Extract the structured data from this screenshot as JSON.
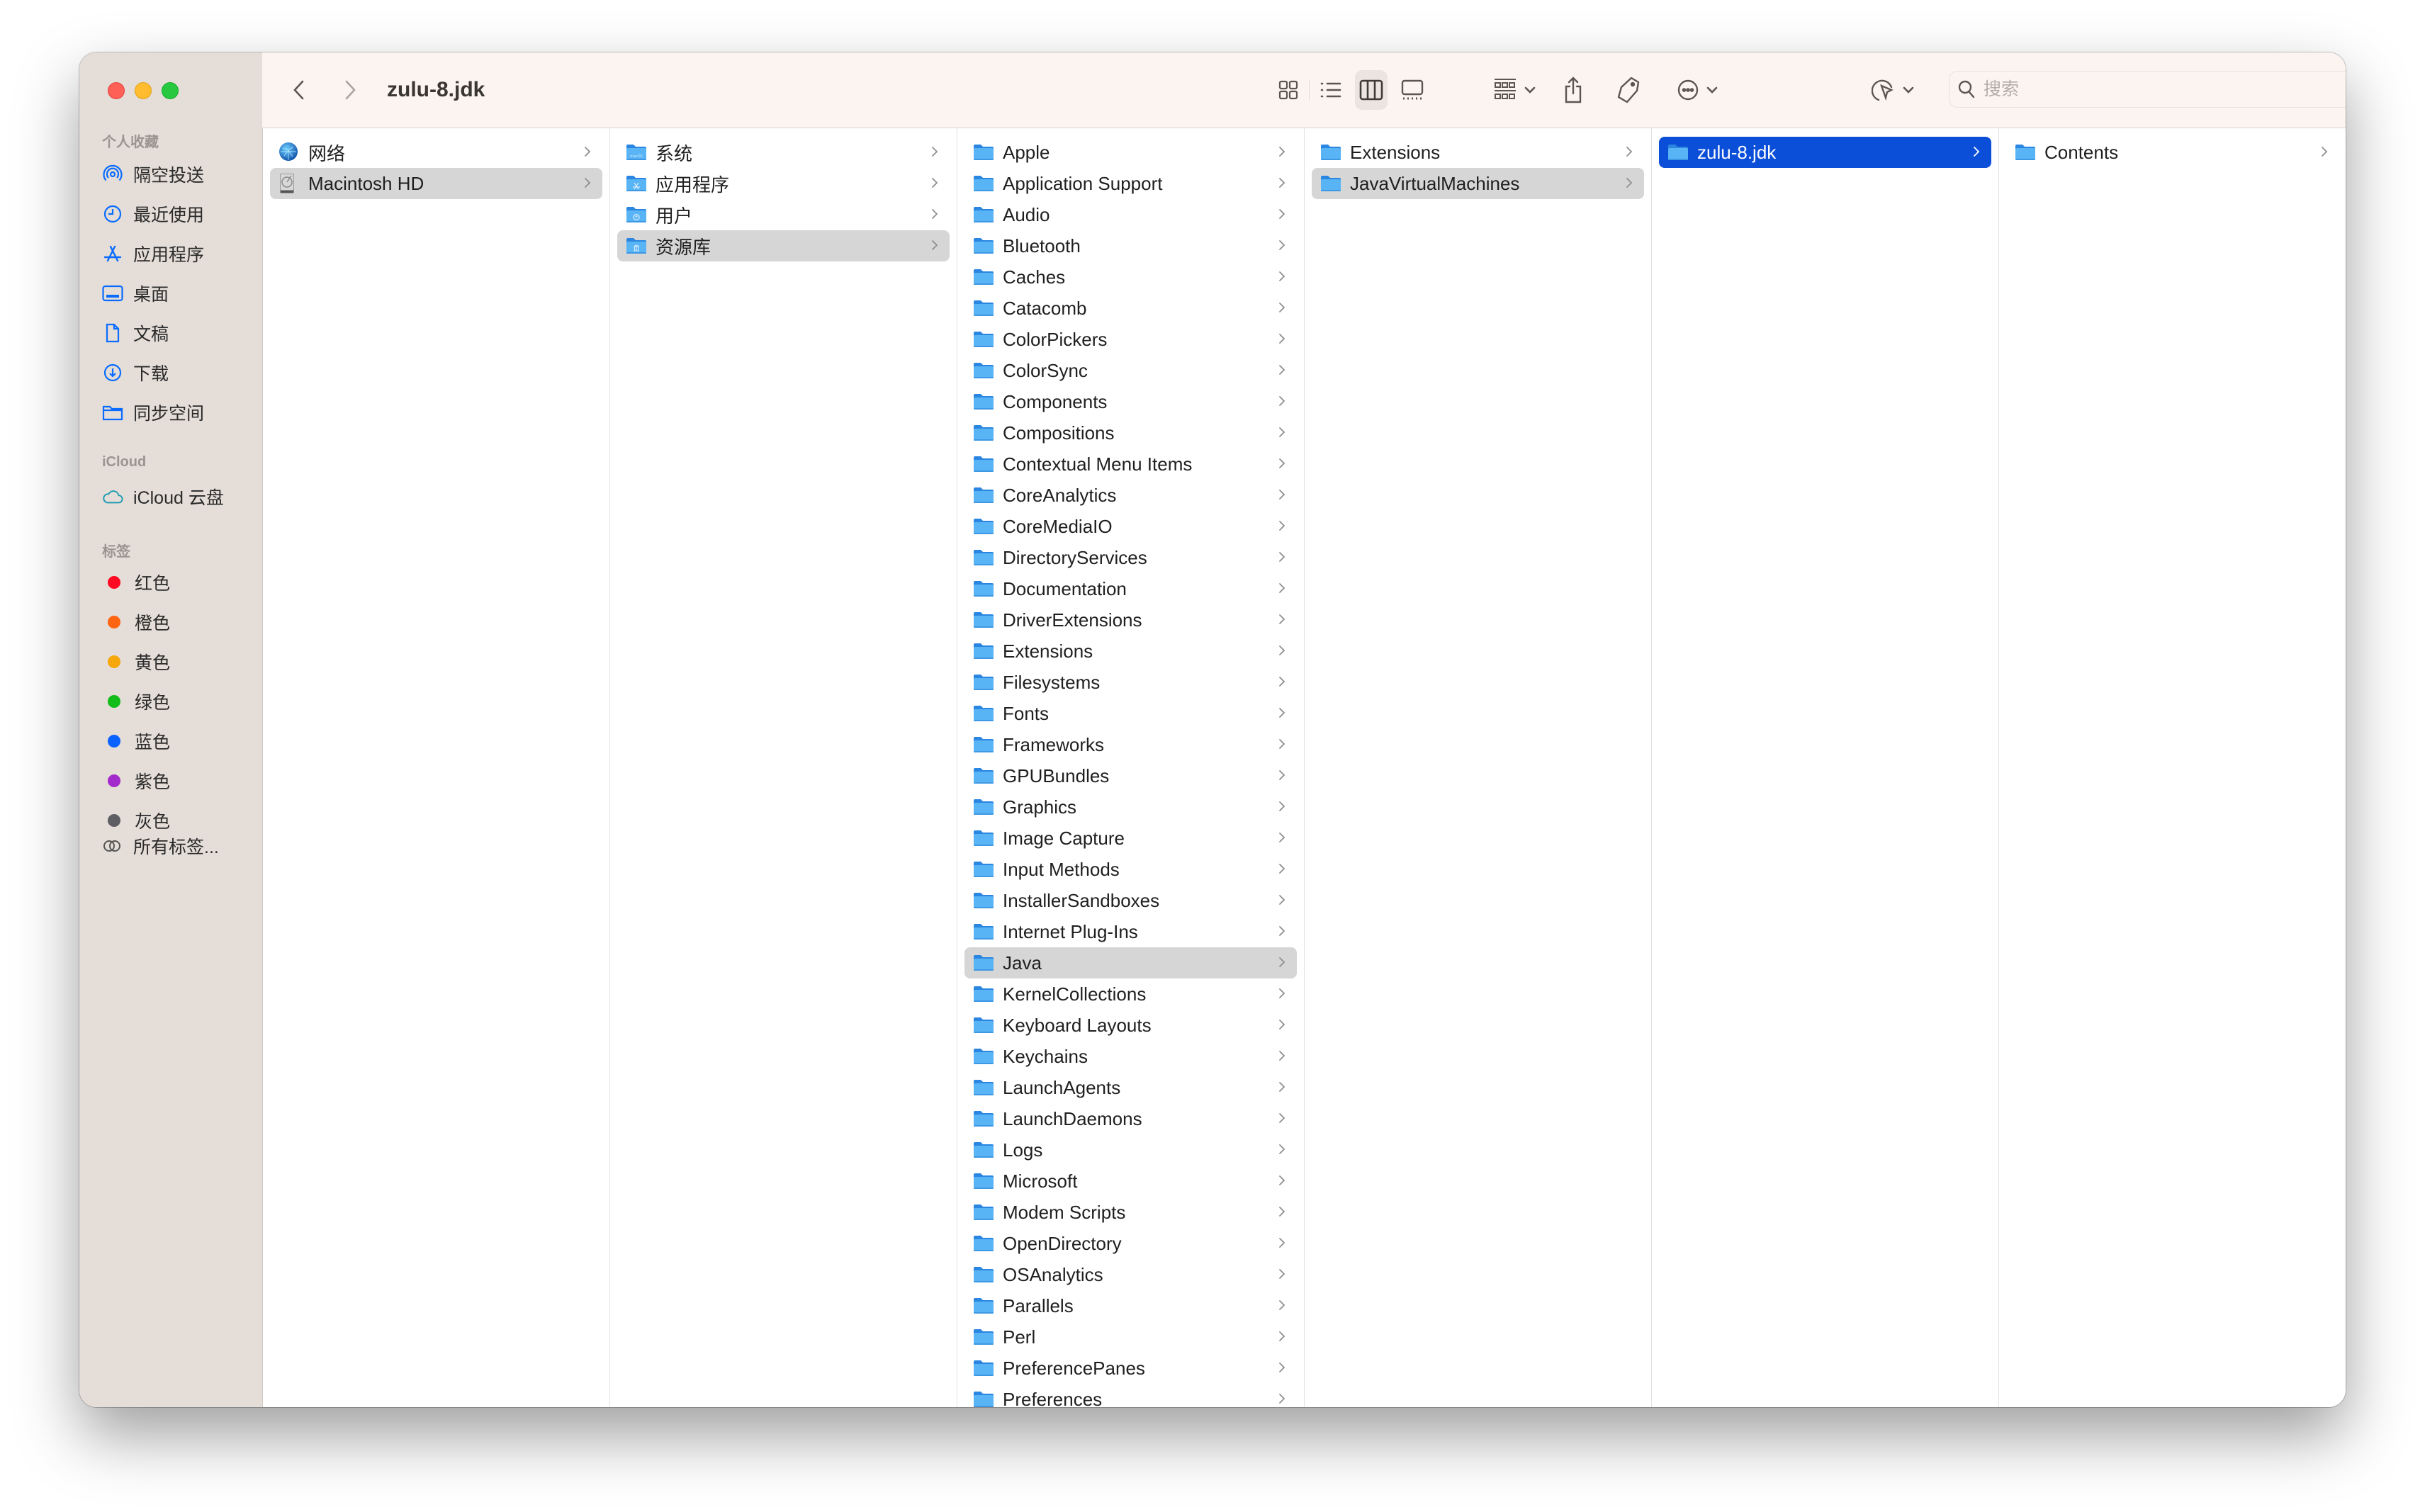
{
  "window": {
    "title": "zulu-8.jdk"
  },
  "toolbar": {
    "back_icon": "chevron-left-icon",
    "forward_icon": "chevron-right-icon",
    "view_icons": [
      "icon-view-icon",
      "list-view-icon",
      "column-view-icon",
      "gallery-view-icon"
    ],
    "active_view": "column-view-icon",
    "group_icon": "group-by-icon",
    "share_icon": "share-icon",
    "tag_icon": "tag-icon",
    "more_icon": "ellipsis-circle-icon",
    "airdrop_icon": "airdrop-icon",
    "search": {
      "placeholder": "搜索",
      "value": ""
    }
  },
  "sidebar": {
    "favorites_label": "个人收藏",
    "favorites": [
      {
        "label": "隔空投送",
        "icon": "airdrop-icon"
      },
      {
        "label": "最近使用",
        "icon": "clock-icon"
      },
      {
        "label": "应用程序",
        "icon": "applications-icon"
      },
      {
        "label": "桌面",
        "icon": "desktop-icon"
      },
      {
        "label": "文稿",
        "icon": "document-icon"
      },
      {
        "label": "下载",
        "icon": "download-icon"
      },
      {
        "label": "同步空间",
        "icon": "folder-icon"
      }
    ],
    "icloud_label": "iCloud",
    "icloud": [
      {
        "label": "iCloud 云盘",
        "icon": "cloud-icon"
      }
    ],
    "tags_label": "标签",
    "tags": [
      {
        "label": "红色",
        "color": "#FF0A22"
      },
      {
        "label": "橙色",
        "color": "#FF6510"
      },
      {
        "label": "黄色",
        "color": "#F5A70B"
      },
      {
        "label": "绿色",
        "color": "#14BC1A"
      },
      {
        "label": "蓝色",
        "color": "#0A63FF"
      },
      {
        "label": "紫色",
        "color": "#A42BCB"
      },
      {
        "label": "灰色",
        "color": "#5F5F63"
      }
    ],
    "all_tags": {
      "label": "所有标签...",
      "icon": "all-tags-icon"
    }
  },
  "columns": [
    {
      "items": [
        {
          "label": "网络",
          "icon": "network-globe-icon"
        },
        {
          "label": "Macintosh HD",
          "icon": "hard-drive-icon",
          "state": "path"
        }
      ]
    },
    {
      "items": [
        {
          "label": "系统",
          "icon": "system-folder-icon"
        },
        {
          "label": "应用程序",
          "icon": "applications-folder-icon"
        },
        {
          "label": "用户",
          "icon": "users-folder-icon"
        },
        {
          "label": "资源库",
          "icon": "library-folder-icon",
          "state": "path"
        }
      ]
    },
    {
      "items": [
        {
          "label": "Apple"
        },
        {
          "label": "Application Support"
        },
        {
          "label": "Audio"
        },
        {
          "label": "Bluetooth"
        },
        {
          "label": "Caches"
        },
        {
          "label": "Catacomb"
        },
        {
          "label": "ColorPickers"
        },
        {
          "label": "ColorSync"
        },
        {
          "label": "Components"
        },
        {
          "label": "Compositions"
        },
        {
          "label": "Contextual Menu Items"
        },
        {
          "label": "CoreAnalytics"
        },
        {
          "label": "CoreMediaIO"
        },
        {
          "label": "DirectoryServices"
        },
        {
          "label": "Documentation"
        },
        {
          "label": "DriverExtensions"
        },
        {
          "label": "Extensions"
        },
        {
          "label": "Filesystems"
        },
        {
          "label": "Fonts"
        },
        {
          "label": "Frameworks"
        },
        {
          "label": "GPUBundles"
        },
        {
          "label": "Graphics"
        },
        {
          "label": "Image Capture"
        },
        {
          "label": "Input Methods"
        },
        {
          "label": "InstallerSandboxes"
        },
        {
          "label": "Internet Plug-Ins"
        },
        {
          "label": "Java",
          "state": "path"
        },
        {
          "label": "KernelCollections"
        },
        {
          "label": "Keyboard Layouts"
        },
        {
          "label": "Keychains"
        },
        {
          "label": "LaunchAgents"
        },
        {
          "label": "LaunchDaemons"
        },
        {
          "label": "Logs"
        },
        {
          "label": "Microsoft"
        },
        {
          "label": "Modem Scripts"
        },
        {
          "label": "OpenDirectory"
        },
        {
          "label": "OSAnalytics"
        },
        {
          "label": "Parallels"
        },
        {
          "label": "Perl"
        },
        {
          "label": "PreferencePanes"
        },
        {
          "label": "Preferences"
        }
      ]
    },
    {
      "items": [
        {
          "label": "Extensions"
        },
        {
          "label": "JavaVirtualMachines",
          "state": "path"
        }
      ]
    },
    {
      "items": [
        {
          "label": "zulu-8.jdk",
          "state": "selected"
        }
      ]
    },
    {
      "items": [
        {
          "label": "Contents"
        }
      ]
    }
  ],
  "colors": {
    "accent": "#0B4FD9",
    "sidebar_bg": "#E4DDD8",
    "toolbar_bg": "#FCF4F0",
    "path_highlight": "#D6D6D6",
    "sidebar_icon": "#0A6CFF"
  }
}
